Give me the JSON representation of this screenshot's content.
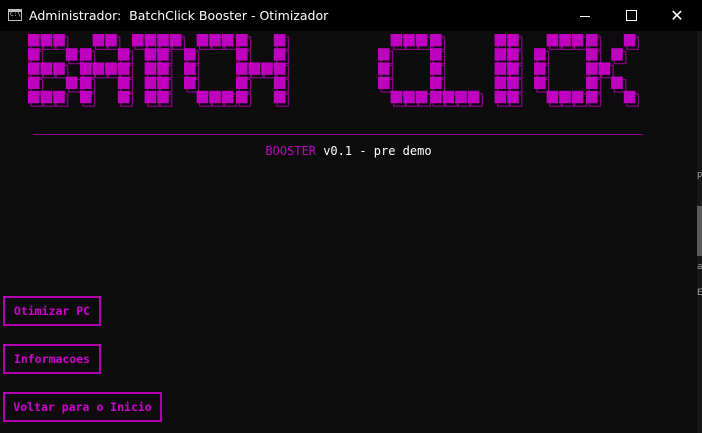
{
  "window": {
    "title": "Administrador:  BatchClick Booster - Otimizador",
    "icon": "console-icon",
    "icon_text": "C:\\",
    "controls": {
      "minimize": "minimize-icon",
      "maximize": "maximize-icon",
      "close": "close-icon"
    }
  },
  "banner": {
    "text": "BATCH CLICK",
    "color": "#c000c0",
    "shadow_color": "#8b008b"
  },
  "version": {
    "accent": "BOOSTER",
    "rest": " v0.1 - pre demo",
    "accent_color": "#c000c0"
  },
  "menu": {
    "optimize_label": "Otimizar PC",
    "info_label": "Informacoes",
    "home_label": "Voltar para o Inicio",
    "border_color": "#b000b0"
  },
  "stray_glyphs": [
    "p",
    "a",
    "E"
  ]
}
